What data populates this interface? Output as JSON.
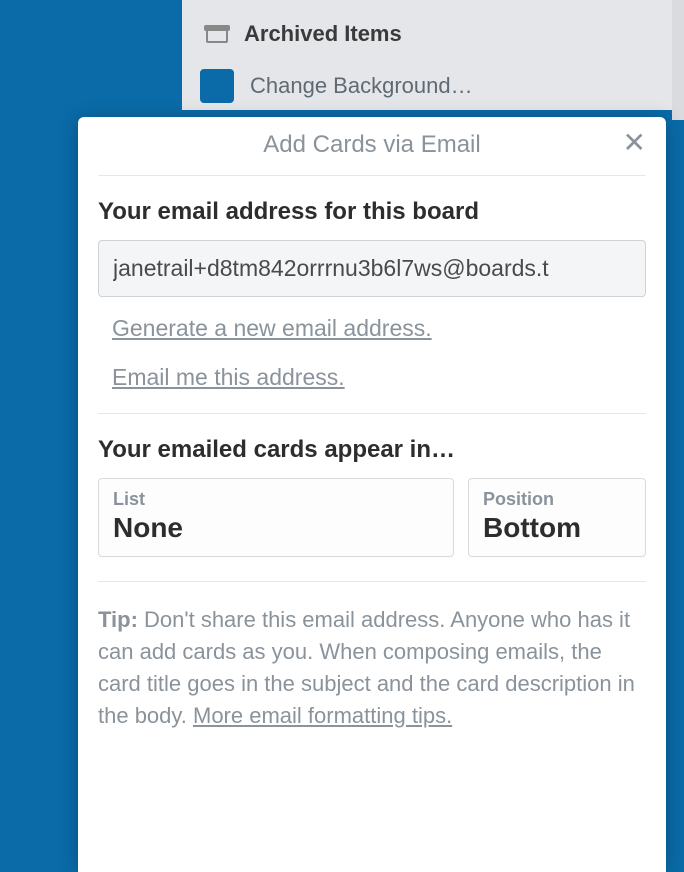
{
  "background": {
    "archived_label": "Archived Items",
    "change_bg_label": "Change Background…"
  },
  "popover": {
    "title": "Add Cards via Email",
    "email_heading": "Your email address for this board",
    "email_value": "janetrail+d8tm842orrrnu3b6l7ws@boards.t",
    "link_generate": "Generate a new email address.",
    "link_email_me": "Email me this address.",
    "appear_heading": "Your emailed cards appear in…",
    "list": {
      "label": "List",
      "value": "None"
    },
    "position": {
      "label": "Position",
      "value": "Bottom"
    },
    "tip_label": "Tip:",
    "tip_text": " Don't share this email address. Anyone who has it can add cards as you. When composing emails, the card title goes in the subject and the card description in the body. ",
    "tip_more": "More email formatting tips."
  }
}
